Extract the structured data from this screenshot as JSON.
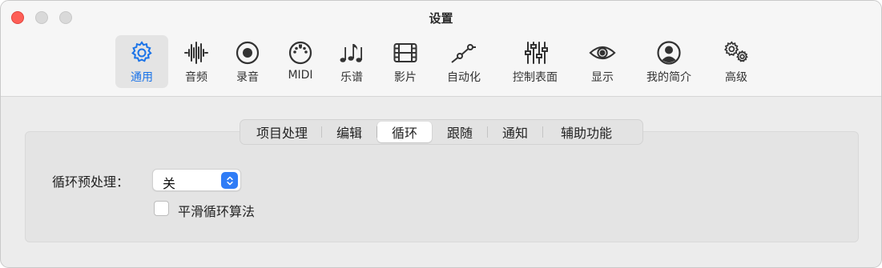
{
  "window": {
    "title": "设置"
  },
  "toolbar": {
    "items": [
      {
        "label": "通用",
        "icon": "gear-icon",
        "selected": true
      },
      {
        "label": "音频",
        "icon": "waveform-icon"
      },
      {
        "label": "录音",
        "icon": "record-icon"
      },
      {
        "label": "MIDI",
        "icon": "midi-port-icon"
      },
      {
        "label": "乐谱",
        "icon": "music-notes-icon"
      },
      {
        "label": "影片",
        "icon": "film-icon"
      },
      {
        "label": "自动化",
        "icon": "automation-curve-icon"
      },
      {
        "label": "控制表面",
        "icon": "sliders-icon"
      },
      {
        "label": "显示",
        "icon": "eye-icon"
      },
      {
        "label": "我的简介",
        "icon": "person-icon"
      },
      {
        "label": "高级",
        "icon": "gears-icon"
      }
    ]
  },
  "tabs": {
    "items": [
      {
        "label": "项目处理"
      },
      {
        "label": "编辑"
      },
      {
        "label": "循环",
        "selected": true
      },
      {
        "label": "跟随"
      },
      {
        "label": "通知"
      },
      {
        "label": "辅助功能"
      }
    ]
  },
  "settings": {
    "loop_preprocess_label": "循环预处理：",
    "loop_preprocess_value": "关",
    "smooth_loop_label": "平滑循环算法",
    "smooth_loop_checked": false
  },
  "colors": {
    "accent": "#1a73e8",
    "close": "#fe5f57",
    "stepper": "#2f7cf6"
  }
}
